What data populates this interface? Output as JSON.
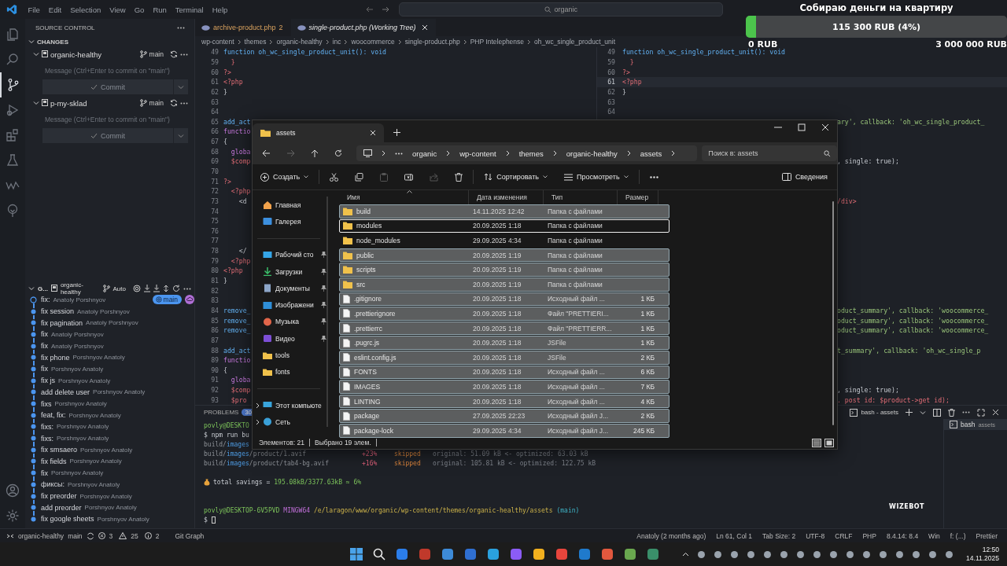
{
  "menu": [
    "File",
    "Edit",
    "Selection",
    "View",
    "Go",
    "Run",
    "Terminal",
    "Help"
  ],
  "command_search": {
    "value": "organic"
  },
  "donation": {
    "title": "Собираю деньги на квартиру",
    "amount": "115 300 RUB (4%)",
    "level": 0.04,
    "min": "0 RUB",
    "max": "3 000 000 RUB"
  },
  "activity_bar": {
    "top": [
      {
        "kind": "files",
        "selected": false
      },
      {
        "kind": "search",
        "selected": false
      },
      {
        "kind": "scm",
        "selected": true
      },
      {
        "kind": "debug",
        "selected": false
      },
      {
        "kind": "extensions",
        "selected": false
      },
      {
        "kind": "testing",
        "selected": false
      },
      {
        "kind": "wave",
        "selected": false
      },
      {
        "kind": "tree",
        "selected": false
      }
    ],
    "bottom": [
      {
        "kind": "account",
        "selected": false
      },
      {
        "kind": "settings",
        "selected": false
      }
    ]
  },
  "sidebar": {
    "title": "SOURCE CONTROL",
    "section": "CHANGES",
    "repos": [
      {
        "name": "organic-healthy",
        "branch": "main",
        "placeholder": "Message (Ctrl+Enter to commit on \"main\")",
        "button": "Commit"
      },
      {
        "name": "p-my-sklad",
        "branch": "main",
        "placeholder": "Message (Ctrl+Enter to commit on \"main\")",
        "button": "Commit"
      }
    ],
    "graph": {
      "title": "G...",
      "repo": "organic-healthy",
      "mode": "Auto",
      "commits": [
        {
          "message": "fix:",
          "author": "Anatoly Porshnyov",
          "head": true,
          "badge": "main"
        },
        {
          "message": "fix session",
          "author": "Anatoly Porshnyov",
          "head": false
        },
        {
          "message": "fix pagination",
          "author": "Anatoly Porshnyov",
          "head": false
        },
        {
          "message": "fix",
          "author": "Anatoly Porshnyov",
          "head": false
        },
        {
          "message": "fix",
          "author": "Anatoly Porshnyov",
          "head": false
        },
        {
          "message": "fix phone",
          "author": "Porshnyov Anatoly",
          "head": false
        },
        {
          "message": "fix",
          "author": "Porshnyov Anatoly",
          "head": false
        },
        {
          "message": "fix js",
          "author": "Porshnyov Anatoly",
          "head": false
        },
        {
          "message": "add delete user",
          "author": "Porshnyov Anatoly",
          "head": false
        },
        {
          "message": "fixs",
          "author": "Porshnyov Anatoly",
          "head": false
        },
        {
          "message": "feat, fix:",
          "author": "Porshnyov Anatoly",
          "head": false
        },
        {
          "message": "fixs:",
          "author": "Porshnyov Anatoly",
          "head": false
        },
        {
          "message": "fixs:",
          "author": "Porshnyov Anatoly",
          "head": false
        },
        {
          "message": "fix smsaero",
          "author": "Porshnyov Anatoly",
          "head": false
        },
        {
          "message": "fix fields",
          "author": "Porshnyov Anatoly",
          "head": false
        },
        {
          "message": "fix",
          "author": "Porshnyov Anatoly",
          "head": false
        },
        {
          "message": "фиксы:",
          "author": "Porshnyov Anatoly",
          "head": false
        },
        {
          "message": "fix preorder",
          "author": "Porshnyov Anatoly",
          "head": false
        },
        {
          "message": "add preorder",
          "author": "Porshnyov Anatoly",
          "head": false
        },
        {
          "message": "fix google sheets",
          "author": "Porshnyov Anatoly",
          "head": false
        }
      ]
    }
  },
  "tabs": [
    {
      "label": "archive-product.php",
      "badge": "2",
      "selected": false
    },
    {
      "label": "single-product.php (Working Tree)",
      "selected": true
    }
  ],
  "breadcrumb": [
    "wp-content",
    "themes",
    "organic-healthy",
    "inc",
    "woocommerce",
    "single-product.php",
    "PHP Intelephense",
    "oh_wc_single_product_unit"
  ],
  "editor": {
    "lines": [
      {
        "n": "49",
        "left": {
          "code": "function oh_wc_single_product_unit(): void",
          "kind": "fn"
        },
        "right": {
          "n": "49",
          "code": "function oh_wc_single_product_unit(): void",
          "kind": "fn",
          "current": false
        }
      },
      {
        "n": "59",
        "left": {
          "code": "  }",
          "kind": "tag"
        },
        "right": {
          "n": "59",
          "code": "  }",
          "kind": "tag",
          "current": false
        }
      },
      {
        "n": "60",
        "left": {
          "code": "?>",
          "kind": "tag"
        },
        "right": {
          "n": "60",
          "code": "?>",
          "kind": "tag",
          "current": false
        }
      },
      {
        "n": "61",
        "left": {
          "code": "<?php",
          "kind": "tag"
        },
        "right": {
          "n": "61",
          "code": "<?php",
          "kind": "tag",
          "current": true
        }
      },
      {
        "n": "62",
        "left": {
          "code": "}",
          "kind": "plain"
        },
        "right": {
          "n": "62",
          "code": "}",
          "kind": "plain",
          "current": false
        }
      },
      {
        "n": "63",
        "right": {
          "n": "63",
          "current": false
        }
      },
      {
        "n": "64",
        "right": {
          "n": "64",
          "current": false
        }
      },
      {
        "n": "65",
        "left": {
          "code": "add_act",
          "kind": "fn"
        },
        "right": {
          "code": "ary', callback: 'oh_wc_single_product_",
          "kind": "string"
        }
      },
      {
        "n": "66",
        "left": {
          "code": "functio",
          "kind": "keyword"
        }
      },
      {
        "n": "67",
        "left": {
          "code": "{",
          "kind": "plain"
        }
      },
      {
        "n": "68",
        "left": {
          "code": "  globa",
          "kind": "keyword"
        }
      },
      {
        "n": "69",
        "left": {
          "code": "  $comp",
          "kind": "var"
        },
        "right": {
          "code": ", single: true);",
          "kind": "plain"
        }
      },
      {
        "n": "70"
      },
      {
        "n": "71",
        "left": {
          "code": "?>",
          "kind": "tag"
        }
      },
      {
        "n": "72",
        "left": {
          "code": "  <?php",
          "kind": "tag"
        }
      },
      {
        "n": "73",
        "left": {
          "code": "    <d",
          "kind": "plain"
        },
        "right": {
          "code": "/div>",
          "kind": "tag"
        }
      },
      {
        "n": "74"
      },
      {
        "n": "75"
      },
      {
        "n": "76"
      },
      {
        "n": "77"
      },
      {
        "n": "78",
        "left": {
          "code": "    </",
          "kind": "plain"
        }
      },
      {
        "n": "79",
        "left": {
          "code": "  <?php",
          "kind": "tag"
        }
      },
      {
        "n": "80",
        "left": {
          "code": "<?php",
          "kind": "tag"
        }
      },
      {
        "n": "81",
        "left": {
          "code": "}",
          "kind": "plain"
        }
      },
      {
        "n": "82"
      },
      {
        "n": "83"
      },
      {
        "n": "84",
        "left": {
          "code": "remove_",
          "kind": "fn"
        },
        "right": {
          "code": "oduct_summary', callback: 'woocommerce_",
          "kind": "string"
        }
      },
      {
        "n": "85",
        "left": {
          "code": "remove_",
          "kind": "fn"
        },
        "right": {
          "code": "oduct_summary', callback: 'woocommerce_",
          "kind": "string"
        }
      },
      {
        "n": "86",
        "left": {
          "code": "remove_",
          "kind": "fn"
        },
        "right": {
          "code": "oduct_summary', callback: 'woocommerce_",
          "kind": "string"
        }
      },
      {
        "n": "87"
      },
      {
        "n": "88",
        "left": {
          "code": "add_act",
          "kind": "fn"
        },
        "right": {
          "code": "t_summary', callback: 'oh_wc_single_p",
          "kind": "string"
        }
      },
      {
        "n": "89",
        "left": {
          "code": "functio",
          "kind": "keyword"
        }
      },
      {
        "n": "90",
        "left": {
          "code": "{",
          "kind": "plain"
        }
      },
      {
        "n": "91",
        "left": {
          "code": "  globa",
          "kind": "keyword"
        }
      },
      {
        "n": "92",
        "left": {
          "code": "  $comp",
          "kind": "var"
        },
        "right": {
          "code": ", single: true);",
          "kind": "plain"
        }
      },
      {
        "n": "93",
        "left": {
          "code": "  $pro",
          "kind": "var"
        },
        "right": {
          "code": ". post id: $product->get id);",
          "kind": "var"
        }
      }
    ]
  },
  "panel": {
    "problems": "PROBLEMS",
    "problems_count": "30",
    "terminal_tab": "bash - assets",
    "terminals": [
      {
        "name": "bash",
        "detail": "assets",
        "selected": true
      }
    ],
    "overlay": "WIZEBOT",
    "lines": [
      {
        "kind": "segments",
        "segments": [
          {
            "text": "povly@DESKTO",
            "kind": "green"
          }
        ]
      },
      {
        "kind": "segments",
        "segments": [
          {
            "text": "$ npm run bu",
            "kind": "plain"
          }
        ]
      },
      {
        "kind": "segments",
        "segments": [
          {
            "text": "build/",
            "kind": "dim"
          },
          {
            "text": "images",
            "kind": "blue"
          }
        ]
      },
      {
        "kind": "stat",
        "path": [
          {
            "text": "build/",
            "kind": "dim"
          },
          {
            "text": "images",
            "kind": "blue"
          },
          {
            "text": "/product/1.avif",
            "kind": "dim"
          }
        ],
        "change": "+23%",
        "status": "skipped",
        "detail": "original: 51.09 kB <- optimized: 63.03 kB"
      },
      {
        "kind": "stat",
        "path": [
          {
            "text": "build/",
            "kind": "dim"
          },
          {
            "text": "images",
            "kind": "blue"
          },
          {
            "text": "/product/tab4-bg.avif",
            "kind": "dim"
          }
        ],
        "change": "+16%",
        "status": "skipped",
        "detail": "original: 105.81 kB <- optimized: 122.75 kB"
      },
      {
        "kind": "blank"
      },
      {
        "kind": "savings",
        "label": "total savings =",
        "value": "195.08kB/3377.63kB ≈ 6%"
      },
      {
        "kind": "blank"
      },
      {
        "kind": "blank"
      },
      {
        "kind": "prompt",
        "user": "povly@DESKTOP-6V5PVD",
        "system": "MINGW64",
        "path": "/e/laragon/www/organic/wp-content/themes/organic-healthy/assets",
        "branch": "(main)"
      },
      {
        "kind": "input",
        "prompt": "$"
      }
    ]
  },
  "status_bar": {
    "repo": "organic-healthy",
    "branch": "main",
    "errors": "3",
    "warnings": "25",
    "infos": "2",
    "git_graph": "Git Graph",
    "right": [
      "Anatoly (2 months ago)",
      "Ln 61, Col 1",
      "Tab Size: 2",
      "UTF-8",
      "CRLF",
      "PHP",
      "8.4.14: 8.4",
      "Win",
      "f: (...)",
      "Prettier"
    ]
  },
  "taskbar": {
    "time": "12:50",
    "date": "14.11.2025"
  },
  "explorer": {
    "tab": "assets",
    "path": [
      "organic",
      "wp-content",
      "themes",
      "organic-healthy",
      "assets"
    ],
    "search_placeholder": "Поиск в: assets",
    "toolbar": {
      "create": "Создать",
      "sort": "Сортировать",
      "view": "Просмотреть",
      "details": "Сведения"
    },
    "nav": [
      [
        {
          "label": "Главная",
          "kind": "home",
          "pinned": false
        },
        {
          "label": "Галерея",
          "kind": "gallery",
          "pinned": false
        }
      ],
      [
        {
          "label": "Рабочий сто",
          "kind": "desktop",
          "pinned": true
        },
        {
          "label": "Загрузки",
          "kind": "downloads",
          "pinned": true
        },
        {
          "label": "Документы",
          "kind": "documents",
          "pinned": true
        },
        {
          "label": "Изображени",
          "kind": "pictures",
          "pinned": true
        },
        {
          "label": "Музыка",
          "kind": "music",
          "pinned": true
        },
        {
          "label": "Видео",
          "kind": "video",
          "pinned": true
        },
        {
          "label": "tools",
          "kind": "folder",
          "pinned": false
        },
        {
          "label": "fonts",
          "kind": "folder",
          "pinned": false
        }
      ],
      [
        {
          "label": "Этот компьюте",
          "kind": "pc",
          "pinned": false
        },
        {
          "label": "Сеть",
          "kind": "network",
          "pinned": false
        }
      ]
    ],
    "columns": [
      "Имя",
      "Дата изменения",
      "Тип",
      "Размер"
    ],
    "files": [
      {
        "name": "build",
        "date": "14.11.2025 12:42",
        "type": "Папка с файлами",
        "kind": "folder",
        "selected": true,
        "focused": false
      },
      {
        "name": "modules",
        "date": "20.09.2025 1:18",
        "type": "Папка с файлами",
        "kind": "folder",
        "selected": false,
        "focused": true
      },
      {
        "name": "node_modules",
        "date": "29.09.2025 4:34",
        "type": "Папка с файлами",
        "kind": "folder",
        "selected": false,
        "focused": false
      },
      {
        "name": "public",
        "date": "20.09.2025 1:19",
        "type": "Папка с файлами",
        "kind": "folder",
        "selected": true,
        "focused": false
      },
      {
        "name": "scripts",
        "date": "20.09.2025 1:19",
        "type": "Папка с файлами",
        "kind": "folder",
        "selected": true,
        "focused": false
      },
      {
        "name": "src",
        "date": "20.09.2025 1:19",
        "type": "Папка с файлами",
        "kind": "folder",
        "selected": true,
        "focused": false
      },
      {
        "name": ".gitignore",
        "date": "20.09.2025 1:18",
        "type": "Исходный файл ...",
        "size": "1 КБ",
        "kind": "file",
        "selected": true,
        "focused": false
      },
      {
        "name": ".prettierignore",
        "date": "20.09.2025 1:18",
        "type": "Файл \"PRETTIERI...",
        "size": "1 КБ",
        "kind": "file",
        "selected": true,
        "focused": false
      },
      {
        "name": ".prettierrc",
        "date": "20.09.2025 1:18",
        "type": "Файл \"PRETTIERR...",
        "size": "1 КБ",
        "kind": "file",
        "selected": true,
        "focused": false
      },
      {
        "name": ".pugrc.js",
        "date": "20.09.2025 1:18",
        "type": "JSFile",
        "size": "1 КБ",
        "kind": "file",
        "selected": true,
        "focused": false
      },
      {
        "name": "eslint.config.js",
        "date": "20.09.2025 1:18",
        "type": "JSFile",
        "size": "2 КБ",
        "kind": "file",
        "selected": true,
        "focused": false
      },
      {
        "name": "FONTS",
        "date": "20.09.2025 1:18",
        "type": "Исходный файл ...",
        "size": "6 КБ",
        "kind": "file",
        "selected": true,
        "focused": false
      },
      {
        "name": "IMAGES",
        "date": "20.09.2025 1:18",
        "type": "Исходный файл ...",
        "size": "7 КБ",
        "kind": "file",
        "selected": true,
        "focused": false
      },
      {
        "name": "LINTING",
        "date": "20.09.2025 1:18",
        "type": "Исходный файл ...",
        "size": "4 КБ",
        "kind": "file",
        "selected": true,
        "focused": false
      },
      {
        "name": "package",
        "date": "27.09.2025 22:23",
        "type": "Исходный файл J...",
        "size": "2 КБ",
        "kind": "file",
        "selected": true,
        "focused": false
      },
      {
        "name": "package-lock",
        "date": "29.09.2025 4:34",
        "type": "Исходный файл J...",
        "size": "245 КБ",
        "kind": "file",
        "selected": true,
        "focused": false
      }
    ],
    "status": {
      "count": "Элементов: 21",
      "selection": "Выбрано 19 элем."
    }
  }
}
